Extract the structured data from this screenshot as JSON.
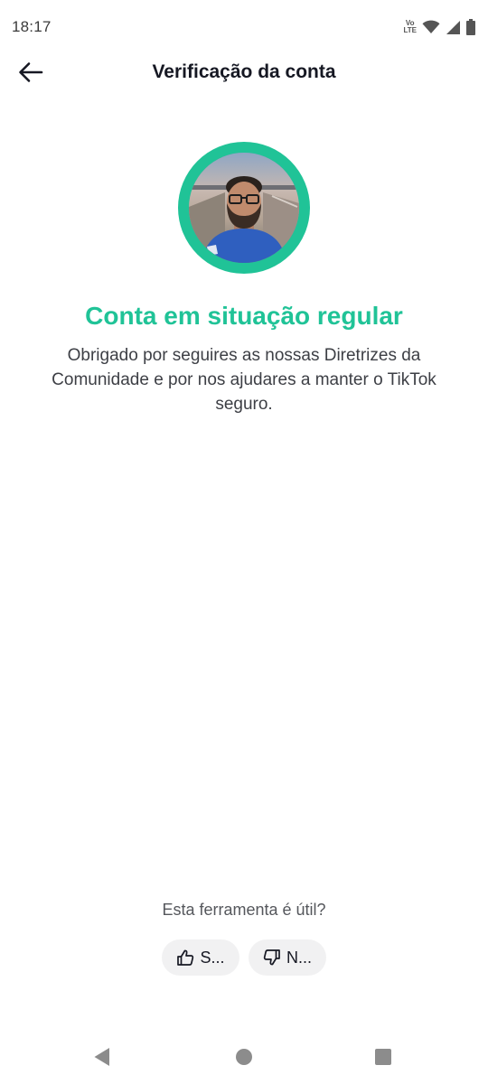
{
  "status_bar": {
    "time": "18:17",
    "volte_top": "Vo",
    "volte_bottom": "LTE",
    "icons": [
      "wifi-icon",
      "cellular-signal-icon",
      "battery-icon"
    ]
  },
  "header": {
    "title": "Verificação da conta",
    "back_icon": "arrow-left-icon"
  },
  "account_status": {
    "headline": "Conta em situação regular",
    "description": "Obrigado por seguires as nossas Diretrizes da Comunidade e por nos ajudares a manter o TikTok seguro."
  },
  "feedback": {
    "question": "Esta ferramenta é útil?",
    "yes_label": "S...",
    "no_label": "N..."
  },
  "nav_bar": {
    "icons": [
      "nav-back-icon",
      "nav-home-icon",
      "nav-recents-icon"
    ]
  },
  "colors": {
    "accent": "#20c397",
    "text_primary": "#161823",
    "text_secondary": "#3d3f45",
    "button_bg": "#f1f1f2"
  }
}
